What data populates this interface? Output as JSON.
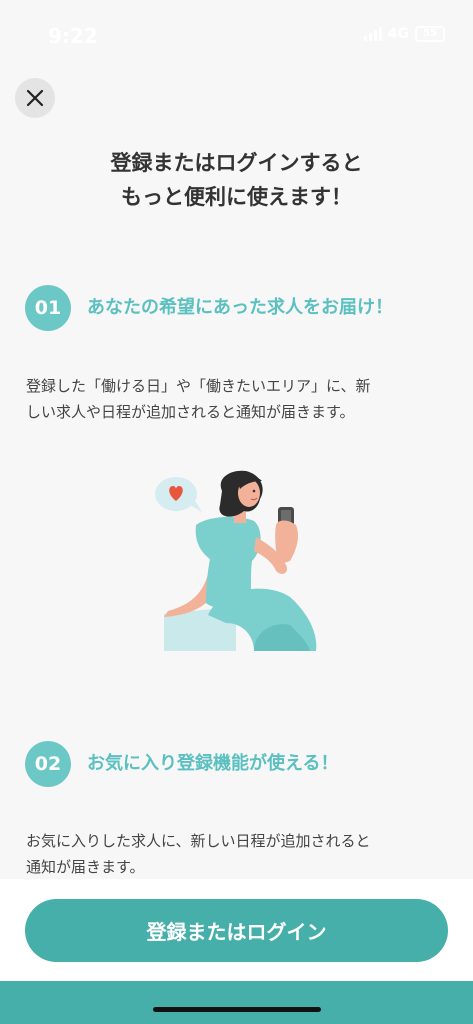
{
  "status_bar": {
    "time": "9:22",
    "network": "4G",
    "battery": "55"
  },
  "close_icon": "close-icon",
  "title": {
    "line1": "登録またはログインすると",
    "line2": "もっと便利に使えます！"
  },
  "steps": [
    {
      "number": "01",
      "heading": "あなたの希望にあった求人をお届け！",
      "desc_line1": "登録した「働ける日」や「働きたいエリア」に、新",
      "desc_line2": "しい求人や日程が追加されると通知が届きます。"
    },
    {
      "number": "02",
      "heading": "お気に入り登録機能が使える！",
      "desc_line1": "お気に入りした求人に、新しい日程が追加されると",
      "desc_line2": "通知が届きます。"
    }
  ],
  "cta": {
    "label": "登録またはログイン"
  },
  "colors": {
    "accent": "#47afa9",
    "heading_teal": "#5cc0c1",
    "badge": "#6cc8c6",
    "heart": "#e8573c"
  }
}
